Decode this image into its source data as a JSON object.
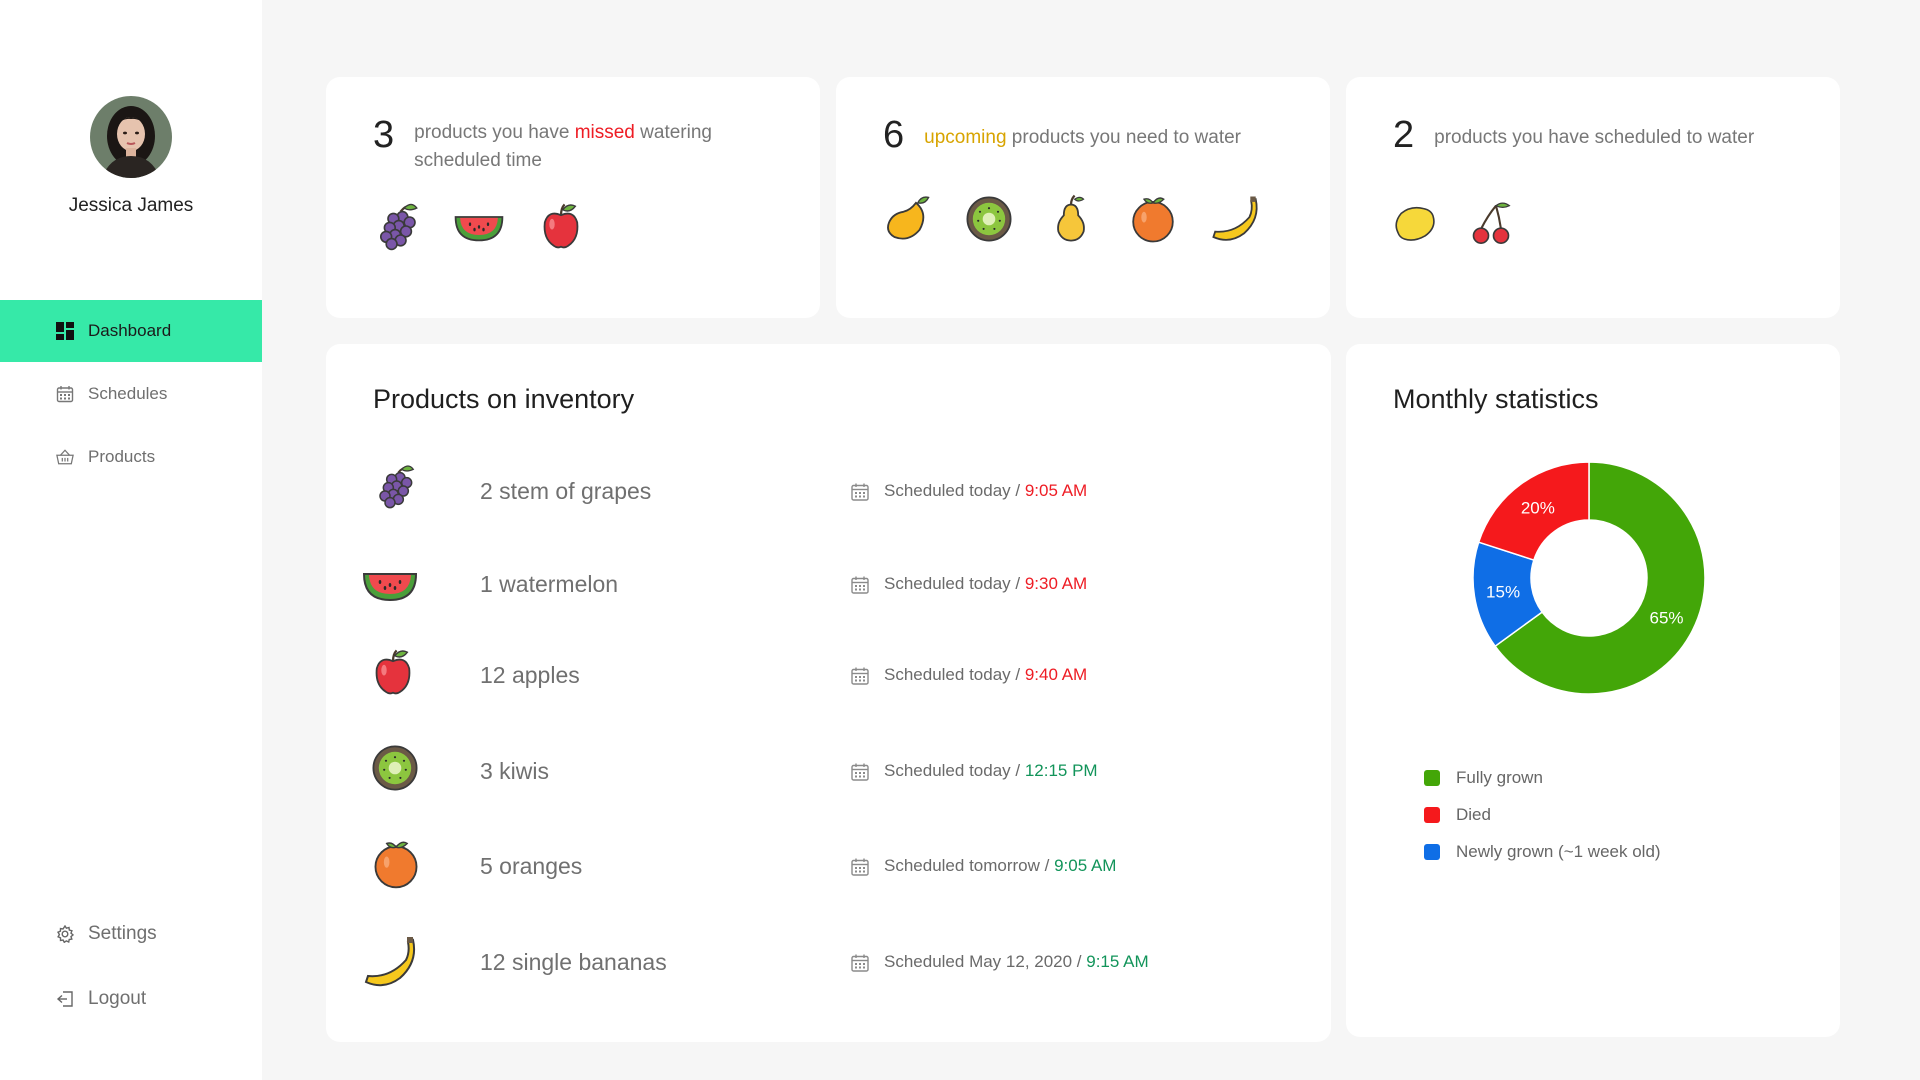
{
  "user": {
    "name": "Jessica James"
  },
  "nav": {
    "items": [
      {
        "label": "Dashboard",
        "icon": "dashboard-icon",
        "active": true
      },
      {
        "label": "Schedules",
        "icon": "calendar-icon",
        "active": false
      },
      {
        "label": "Products",
        "icon": "basket-icon",
        "active": false
      }
    ],
    "settings": "Settings",
    "logout": "Logout"
  },
  "summary": {
    "missed": {
      "count": "3",
      "pre": "products you have ",
      "highlight": "missed",
      "post": " watering scheduled time",
      "fruits": [
        "grapes-icon",
        "watermelon-icon",
        "apple-icon"
      ]
    },
    "upcoming": {
      "count": "6",
      "highlight": "upcoming",
      "post": " products you need to water",
      "fruits": [
        "mango-icon",
        "kiwi-icon",
        "pear-icon",
        "orange-icon",
        "banana-icon"
      ]
    },
    "scheduled": {
      "count": "2",
      "text": "products you have scheduled to water",
      "fruits": [
        "lemon-icon",
        "cherry-icon"
      ]
    }
  },
  "inventory": {
    "title": "Products on inventory",
    "rows": [
      {
        "fruit": "grapes-icon",
        "name": "2 stem of grapes",
        "when": "Scheduled today / ",
        "time": "9:05 AM",
        "status": "missed"
      },
      {
        "fruit": "watermelon-icon",
        "name": "1 watermelon",
        "when": "Scheduled today / ",
        "time": "9:30 AM",
        "status": "missed"
      },
      {
        "fruit": "apple-icon",
        "name": "12 apples",
        "when": "Scheduled today / ",
        "time": "9:40 AM",
        "status": "missed"
      },
      {
        "fruit": "kiwi-icon",
        "name": "3 kiwis",
        "when": "Scheduled today / ",
        "time": "12:15 PM",
        "status": "upcoming"
      },
      {
        "fruit": "orange-icon",
        "name": "5 oranges",
        "when": "Scheduled tomorrow / ",
        "time": "9:05 AM",
        "status": "upcoming"
      },
      {
        "fruit": "banana-icon",
        "name": "12 single bananas",
        "when": "Scheduled May 12, 2020 / ",
        "time": "9:15 AM",
        "status": "upcoming"
      }
    ]
  },
  "stats": {
    "title": "Monthly statistics",
    "colors": {
      "green": "#43a608",
      "red": "#f5191c",
      "blue": "#0f6ee6"
    }
  },
  "chart_data": {
    "type": "pie",
    "title": "Monthly statistics",
    "categories": [
      "Fully grown",
      "Died",
      "Newly grown (~1 week old)"
    ],
    "values": [
      65,
      20,
      15
    ],
    "labels": [
      "65%",
      "20%",
      "15%"
    ],
    "colors": [
      "#43a608",
      "#f5191c",
      "#0f6ee6"
    ],
    "legend": "bottom-left"
  }
}
